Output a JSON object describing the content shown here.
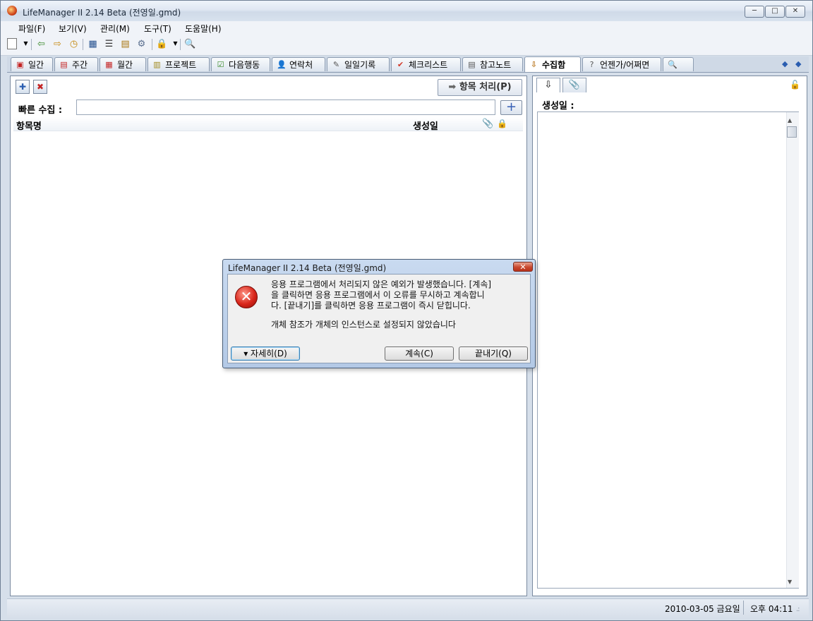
{
  "window": {
    "title": "LifeManager II 2.14 Beta (전영일.gmd)",
    "controls": [
      "─",
      "□",
      "✕"
    ]
  },
  "menu": [
    "파일(F)",
    "보기(V)",
    "관리(M)",
    "도구(T)",
    "도움말(H)"
  ],
  "tabs": [
    {
      "label": "일간",
      "icon": "calendar-day-icon"
    },
    {
      "label": "주간",
      "icon": "calendar-week-icon"
    },
    {
      "label": "월간",
      "icon": "calendar-month-icon"
    },
    {
      "label": "프로젝트",
      "icon": "project-icon"
    },
    {
      "label": "다음행동",
      "icon": "next-action-icon"
    },
    {
      "label": "연락처",
      "icon": "contact-icon"
    },
    {
      "label": "일일기록",
      "icon": "journal-icon"
    },
    {
      "label": "체크리스트",
      "icon": "checklist-icon"
    },
    {
      "label": "참고노트",
      "icon": "notes-icon"
    },
    {
      "label": "수집함",
      "icon": "inbox-icon",
      "active": true
    },
    {
      "label": "언젠가/어쩌면",
      "icon": "someday-icon"
    }
  ],
  "left": {
    "process_button": "항목 처리(P)",
    "quick_collect_label": "빠른 수집 :",
    "quick_collect_value": "",
    "add_button": "+",
    "columns": {
      "name": "항목명",
      "created": "생성일"
    }
  },
  "right": {
    "created_label": "생성일 :"
  },
  "status": {
    "date": "2010-03-05 금요일",
    "time": "오후 04:11"
  },
  "dialog": {
    "title": "LifeManager II 2.14 Beta (전영일.gmd)",
    "close": "✕",
    "icon_glyph": "✕",
    "message": "응용 프로그램에서 처리되지 않은 예외가 발생했습니다. [계속]\n을 클릭하면 응용 프로그램에서 이 오류를 무시하고 계속합니\n다. [끝내기]를 클릭하면 응용 프로그램이 즉시 닫힙니다.",
    "detail": "개체 참조가 개체의 인스턴스로 설정되지 않았습니다",
    "details_button": "▾ 자세히(D)",
    "continue_button": "계속(C)",
    "quit_button": "끝내기(Q)"
  }
}
